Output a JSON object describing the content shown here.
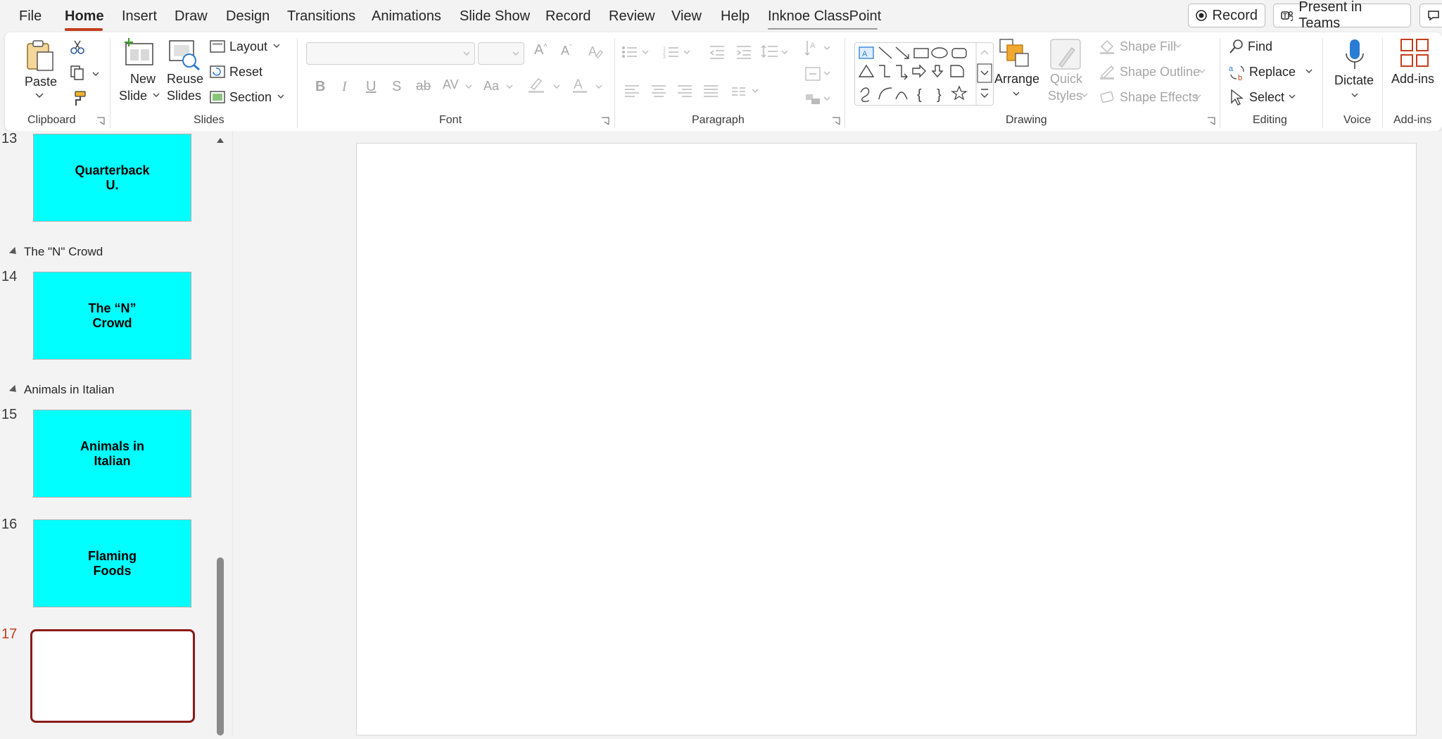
{
  "menu": {
    "tabs": [
      "File",
      "Home",
      "Insert",
      "Draw",
      "Design",
      "Transitions",
      "Animations",
      "Slide Show",
      "Record",
      "Review",
      "View",
      "Help",
      "Inknoe ClassPoint"
    ],
    "active_tab": "Home",
    "record_button": "Record",
    "present_button": "Present in Teams"
  },
  "ribbon": {
    "clipboard": {
      "paste": "Paste",
      "group": "Clipboard"
    },
    "slides": {
      "new_slide_1": "New",
      "new_slide_2": "Slide",
      "reuse_1": "Reuse",
      "reuse_2": "Slides",
      "layout": "Layout",
      "reset": "Reset",
      "section": "Section",
      "group": "Slides"
    },
    "font": {
      "group": "Font"
    },
    "paragraph": {
      "group": "Paragraph"
    },
    "drawing": {
      "arrange": "Arrange",
      "quick_1": "Quick",
      "quick_2": "Styles",
      "shape_fill": "Shape Fill",
      "shape_outline": "Shape Outline",
      "shape_effects": "Shape Effects",
      "group": "Drawing"
    },
    "editing": {
      "find": "Find",
      "replace": "Replace",
      "select": "Select",
      "group": "Editing"
    },
    "voice": {
      "dictate": "Dictate",
      "group": "Voice"
    },
    "addins": {
      "label": "Add-ins",
      "group": "Add-ins"
    }
  },
  "thumbnails": {
    "slides": [
      {
        "num": "13",
        "text": "Quarterback\nU."
      },
      {
        "num": "14",
        "text": "The “N”\nCrowd"
      },
      {
        "num": "15",
        "text": "Animals in\nItalian"
      },
      {
        "num": "16",
        "text": "Flaming\nFoods"
      },
      {
        "num": "17",
        "text": ""
      }
    ],
    "sections": [
      "The \"N\" Crowd",
      "Animals in Italian"
    ]
  },
  "colors": {
    "accent": "#c43e1c",
    "thumb_fill": "#00ffff",
    "selected_border": "#8b1a1a"
  }
}
